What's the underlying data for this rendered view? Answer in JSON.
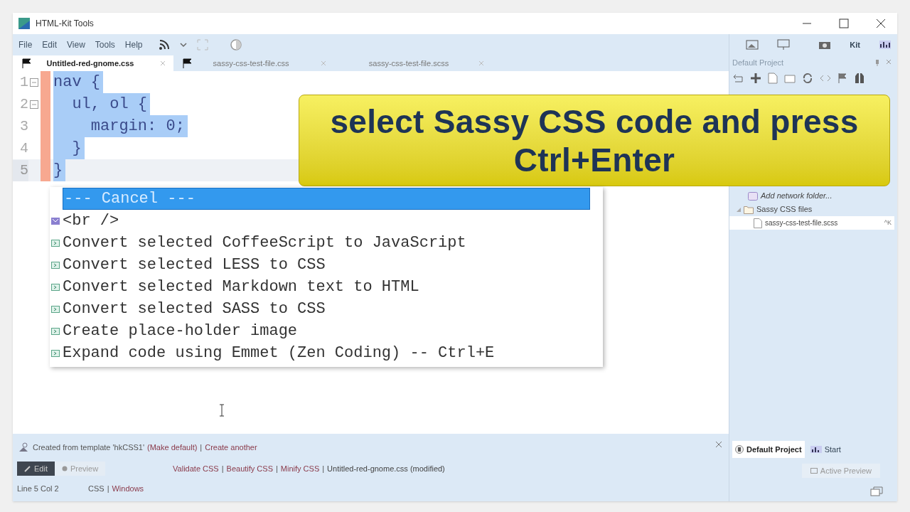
{
  "window": {
    "title": "HTML-Kit Tools"
  },
  "menu": [
    "File",
    "Edit",
    "View",
    "Tools",
    "Help"
  ],
  "tabs": [
    {
      "label": "Untitled-red-gnome.css",
      "selected": true
    },
    {
      "label": "sassy-css-test-file.css",
      "selected": false
    },
    {
      "label": "sassy-css-test-file.scss",
      "selected": false
    }
  ],
  "editor": {
    "lines": [
      {
        "number": "1",
        "text": "nav {",
        "current": false
      },
      {
        "number": "2",
        "text": "  ul, ol {",
        "current": false
      },
      {
        "number": "3",
        "text": "    margin: 0;",
        "current": false
      },
      {
        "number": "4",
        "text": "  }",
        "current": false
      },
      {
        "number": "5",
        "text": "}",
        "current": true
      }
    ]
  },
  "popup_menu": [
    {
      "label": "--- Cancel ---",
      "selected": true,
      "kind": "plain"
    },
    {
      "label": "<br />",
      "selected": false,
      "kind": "tag"
    },
    {
      "label": "Convert selected CoffeeScript to JavaScript",
      "selected": false,
      "kind": "command"
    },
    {
      "label": "Convert selected LESS to CSS",
      "selected": false,
      "kind": "command"
    },
    {
      "label": "Convert selected Markdown text to HTML",
      "selected": false,
      "kind": "command"
    },
    {
      "label": "Convert selected SASS to CSS",
      "selected": false,
      "kind": "command"
    },
    {
      "label": "Create place-holder image",
      "selected": false,
      "kind": "command"
    },
    {
      "label": "Expand code using Emmet (Zen Coding) -- Ctrl+E",
      "selected": false,
      "kind": "command"
    }
  ],
  "callout": {
    "lines": [
      "select Sassy CSS code and press",
      "Ctrl+Enter"
    ]
  },
  "right_panel": {
    "kit_label": "Kit",
    "title": "Default Project",
    "tree": [
      {
        "label": "Add network folder...",
        "kind": "action",
        "selected": false
      },
      {
        "label": "Sassy CSS files",
        "kind": "folder",
        "selected": false,
        "children": [
          {
            "label": "sassy-css-test-file.scss",
            "kind": "file",
            "selected": true,
            "shortcut": "^K"
          }
        ]
      }
    ],
    "tabs": [
      {
        "label": "Default Project",
        "selected": true
      },
      {
        "label": "Start",
        "selected": false
      }
    ],
    "active_preview": "Active Preview"
  },
  "notice": {
    "text": "Created from template 'hkCSS1'",
    "links": [
      "(Make default)",
      "Create another"
    ],
    "separator": "|"
  },
  "separator": "|",
  "modes": [
    {
      "label": "Edit",
      "selected": true
    },
    {
      "label": "Preview",
      "selected": false
    }
  ],
  "actions": [
    "Validate CSS",
    "Beautify CSS",
    "Minify CSS"
  ],
  "file_status": "Untitled-red-gnome.css (modified)",
  "status_bar": {
    "position": "Line 5 Col 2",
    "language": "CSS",
    "separator": "|",
    "line_endings": "Windows"
  }
}
